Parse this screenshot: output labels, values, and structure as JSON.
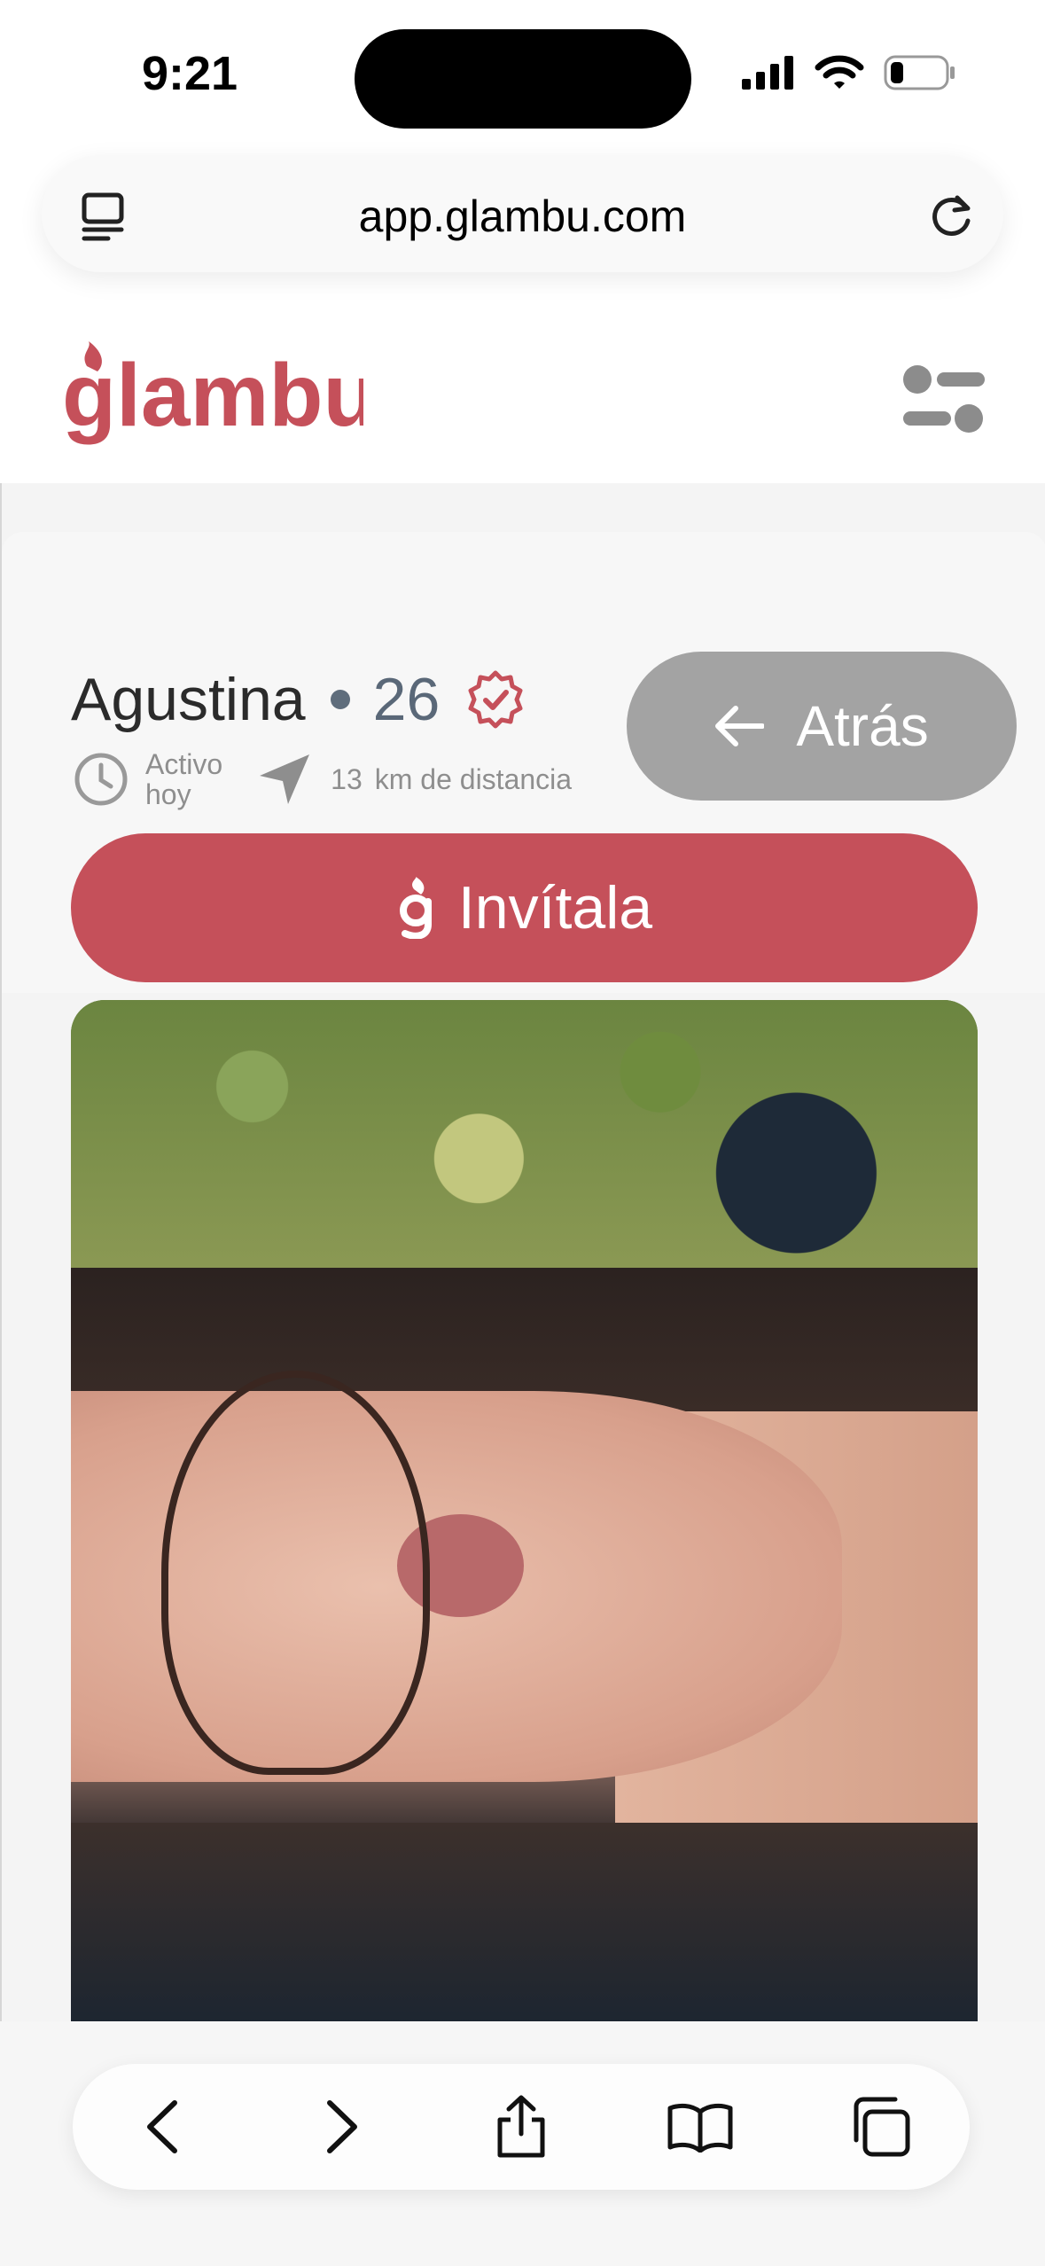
{
  "status_bar": {
    "time": "9:21"
  },
  "browser": {
    "url": "app.glambu.com"
  },
  "app": {
    "logo_text": "glambu"
  },
  "profile": {
    "name": "Agustina",
    "age": "26",
    "active_label": "Activo",
    "active_when": "hoy",
    "distance_value": "13",
    "distance_label": "km de distancia"
  },
  "buttons": {
    "back_label": "Atrás",
    "invite_label": "Invítala"
  },
  "colors": {
    "brand": "#c5505a",
    "back_button": "#a3a3a3",
    "verified": "#c5505a"
  },
  "icons": [
    "reader-mode-icon",
    "reload-icon",
    "filter-icon",
    "verified-badge-icon",
    "clock-icon",
    "location-arrow-icon",
    "arrow-left-icon",
    "glambu-g-icon",
    "back-nav-icon",
    "forward-nav-icon",
    "share-icon",
    "bookmarks-icon",
    "tabs-icon"
  ]
}
